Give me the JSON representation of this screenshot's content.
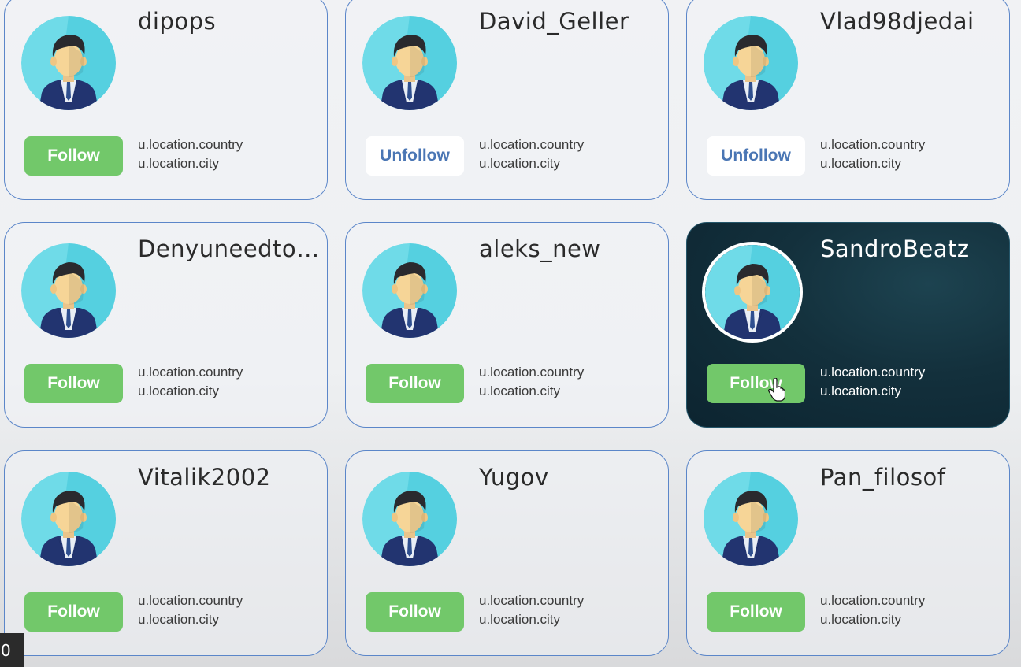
{
  "users": [
    {
      "name": "dipops",
      "button": "Follow",
      "button_state": "follow",
      "country": "u.location.country",
      "city": "u.location.city",
      "active": false
    },
    {
      "name": "David_Geller",
      "button": "Unfollow",
      "button_state": "unfollow",
      "country": "u.location.country",
      "city": "u.location.city",
      "active": false
    },
    {
      "name": "Vlad98djedai",
      "button": "Unfollow",
      "button_state": "unfollow",
      "country": "u.location.country",
      "city": "u.location.city",
      "active": false
    },
    {
      "name": "Denyuneedtok...",
      "button": "Follow",
      "button_state": "follow",
      "country": "u.location.country",
      "city": "u.location.city",
      "active": false
    },
    {
      "name": "aleks_new",
      "button": "Follow",
      "button_state": "follow",
      "country": "u.location.country",
      "city": "u.location.city",
      "active": false
    },
    {
      "name": "SandroBeatz",
      "button": "Follow",
      "button_state": "follow",
      "country": "u.location.country",
      "city": "u.location.city",
      "active": true
    },
    {
      "name": "Vitalik2002",
      "button": "Follow",
      "button_state": "follow",
      "country": "u.location.country",
      "city": "u.location.city",
      "active": false
    },
    {
      "name": "Yugov",
      "button": "Follow",
      "button_state": "follow",
      "country": "u.location.country",
      "city": "u.location.city",
      "active": false
    },
    {
      "name": "Pan_filosof",
      "button": "Follow",
      "button_state": "follow",
      "country": "u.location.country",
      "city": "u.location.city",
      "active": false
    }
  ],
  "avatar_icon": "user-avatar-icon",
  "corner_badge": "0",
  "colors": {
    "follow": "#72c86a",
    "unfollow_text": "#4a76b4",
    "card_border": "#5b86c9",
    "active_card": "#13303c"
  }
}
